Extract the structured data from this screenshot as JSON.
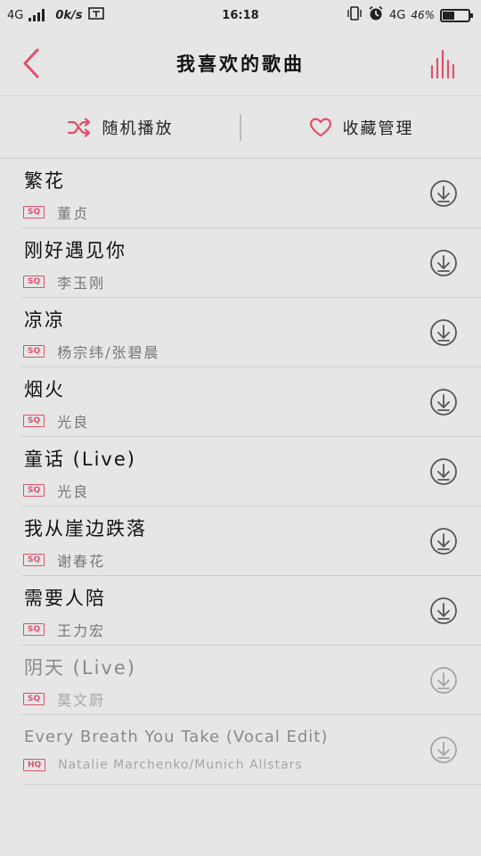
{
  "status_bar": {
    "network_left": "4G",
    "speed": "0k/s",
    "time": "16:18",
    "network_right": "4G",
    "battery_text": "46%",
    "battery_level": 0.46
  },
  "header": {
    "title": "我喜欢的歌曲",
    "accent_color": "#e0506a"
  },
  "actions": {
    "shuffle_label": "随机播放",
    "manage_label": "收藏管理"
  },
  "songs": [
    {
      "title": "繁花",
      "quality": "SQ",
      "artist": "董贞",
      "dimmed": false
    },
    {
      "title": "刚好遇见你",
      "quality": "SQ",
      "artist": "李玉刚",
      "dimmed": false
    },
    {
      "title": "凉凉",
      "quality": "SQ",
      "artist": "杨宗纬/张碧晨",
      "dimmed": false
    },
    {
      "title": "烟火",
      "quality": "SQ",
      "artist": "光良",
      "dimmed": false
    },
    {
      "title": "童话 (Live)",
      "quality": "SQ",
      "artist": "光良",
      "dimmed": false
    },
    {
      "title": "我从崖边跌落",
      "quality": "SQ",
      "artist": "谢春花",
      "dimmed": false
    },
    {
      "title": "需要人陪",
      "quality": "SQ",
      "artist": "王力宏",
      "dimmed": false
    },
    {
      "title": "阴天 (Live)",
      "quality": "SQ",
      "artist": "莫文蔚",
      "dimmed": true
    },
    {
      "title": "Every Breath You Take (Vocal Edit)",
      "quality": "HQ",
      "artist": "Natalie Marchenko/Munich Allstars",
      "dimmed": true
    }
  ]
}
